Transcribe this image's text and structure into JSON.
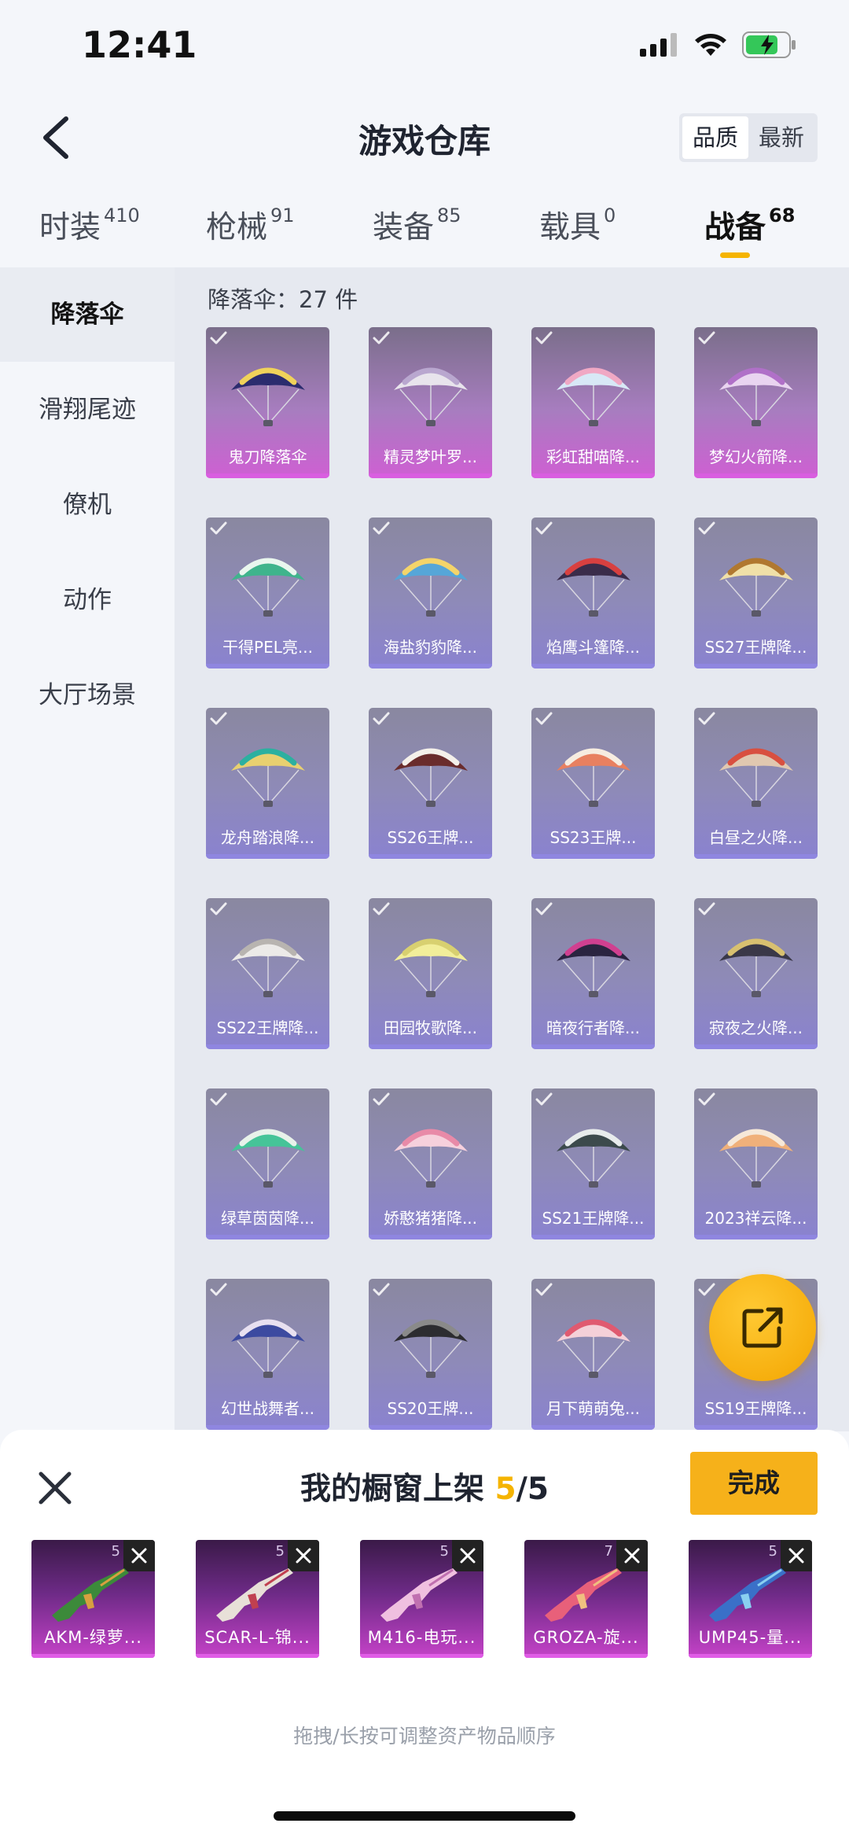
{
  "status_bar": {
    "time": "12:41"
  },
  "header": {
    "title": "游戏仓库",
    "sort_options": [
      "品质",
      "最新"
    ],
    "sort_active": "品质"
  },
  "tabs": [
    {
      "label": "时装",
      "count": "410"
    },
    {
      "label": "枪械",
      "count": "91"
    },
    {
      "label": "装备",
      "count": "85"
    },
    {
      "label": "载具",
      "count": "0"
    },
    {
      "label": "战备",
      "count": "68",
      "active": true
    }
  ],
  "sidebar": {
    "items": [
      "降落伞",
      "滑翔尾迹",
      "僚机",
      "动作",
      "大厅场景"
    ],
    "active": "降落伞"
  },
  "content": {
    "section_label": "降落伞：27 件",
    "items": [
      {
        "name": "鬼刀降落伞",
        "rarity": "pink"
      },
      {
        "name": "精灵梦叶罗...",
        "rarity": "pink"
      },
      {
        "name": "彩虹甜喵降...",
        "rarity": "pink"
      },
      {
        "name": "梦幻火箭降...",
        "rarity": "pink"
      },
      {
        "name": "干得PEL亮...",
        "rarity": "purple"
      },
      {
        "name": "海盐豹豹降...",
        "rarity": "purple"
      },
      {
        "name": "焰鹰斗篷降...",
        "rarity": "purple"
      },
      {
        "name": "SS27王牌降...",
        "rarity": "purple"
      },
      {
        "name": "龙舟踏浪降...",
        "rarity": "purple"
      },
      {
        "name": "SS26王牌...",
        "rarity": "purple"
      },
      {
        "name": "SS23王牌...",
        "rarity": "purple"
      },
      {
        "name": "白昼之火降...",
        "rarity": "purple"
      },
      {
        "name": "SS22王牌降...",
        "rarity": "purple"
      },
      {
        "name": "田园牧歌降...",
        "rarity": "purple"
      },
      {
        "name": "暗夜行者降...",
        "rarity": "purple"
      },
      {
        "name": "寂夜之火降...",
        "rarity": "purple"
      },
      {
        "name": "绿草茵茵降...",
        "rarity": "purple"
      },
      {
        "name": "娇憨猪猪降...",
        "rarity": "purple"
      },
      {
        "name": "SS21王牌降...",
        "rarity": "purple"
      },
      {
        "name": "2023祥云降...",
        "rarity": "purple"
      },
      {
        "name": "幻世战舞者...",
        "rarity": "purple"
      },
      {
        "name": "SS20王牌...",
        "rarity": "purple"
      },
      {
        "name": "月下萌萌兔...",
        "rarity": "purple"
      },
      {
        "name": "SS19王牌降...",
        "rarity": "purple"
      }
    ]
  },
  "sheet": {
    "title_prefix": "我的橱窗上架 ",
    "current": "5",
    "total": "/5",
    "done_label": "完成",
    "items": [
      {
        "name": "AKM-绿萝...",
        "count": "5"
      },
      {
        "name": "SCAR-L-锦...",
        "count": "5"
      },
      {
        "name": "M416-电玩...",
        "count": "5"
      },
      {
        "name": "GROZA-旋...",
        "count": "7"
      },
      {
        "name": "UMP45-量...",
        "count": "5"
      }
    ],
    "hint": "拖拽/长按可调整资产物品顺序"
  },
  "colors": {
    "accent": "#f5b400",
    "pink_card": "#cf5fd3",
    "purple_card": "#8a82d0"
  }
}
